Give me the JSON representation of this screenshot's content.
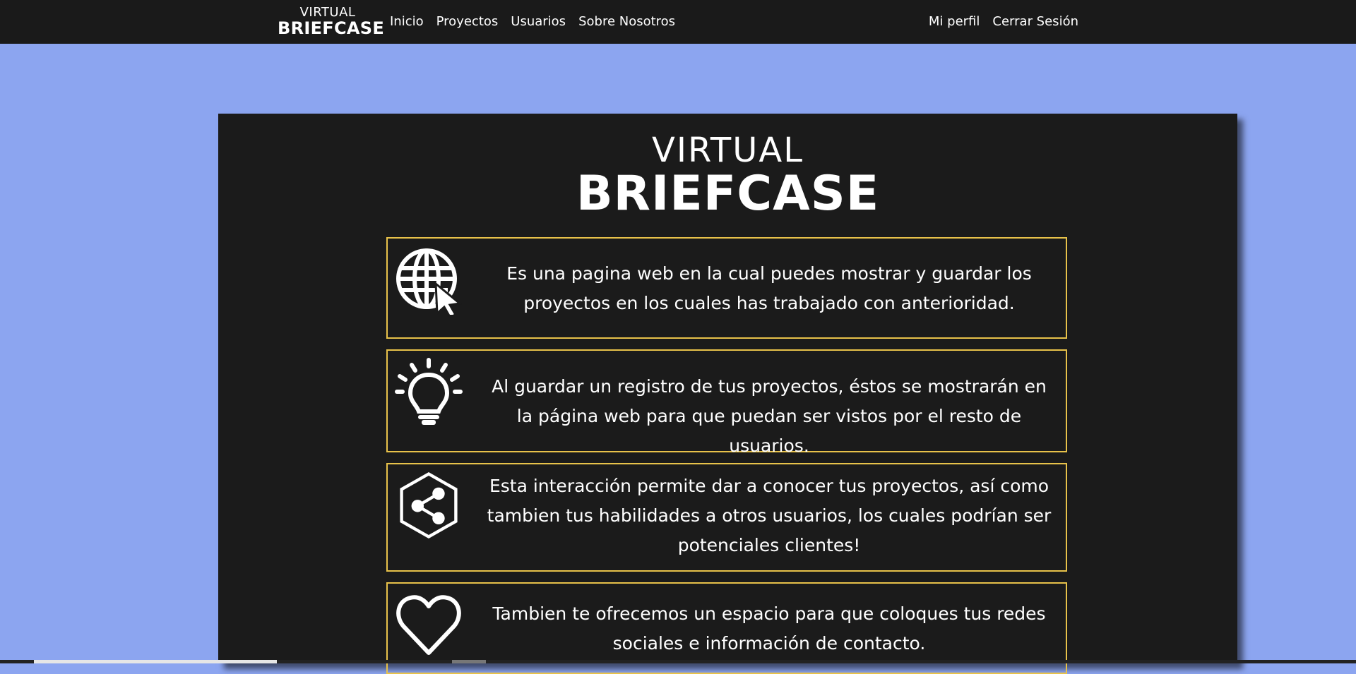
{
  "nav": {
    "logo": {
      "line1": "VIRTUAL",
      "line2": "BRIEFCASE"
    },
    "links": [
      "Inicio",
      "Proyectos",
      "Usuarios",
      "Sobre Nosotros"
    ],
    "right_links": [
      "Mi perfil",
      "Cerrar Sesión"
    ]
  },
  "hero": {
    "line1": "VIRTUAL",
    "line2": "BRIEFCASE"
  },
  "cards": [
    {
      "icon": "globe-cursor-icon",
      "text": "Es una pagina web en la cual puedes mostrar y guardar los proyectos en los cuales has trabajado con anterioridad."
    },
    {
      "icon": "lightbulb-icon",
      "text": "Al guardar un registro de tus proyectos, éstos se mostrarán en la página web para que puedan ser vistos por el resto de usuarios."
    },
    {
      "icon": "share-hexagon-icon",
      "text": "Esta interacción permite dar a conocer tus proyectos, así como tambien tus habilidades a otros usuarios, los cuales podrían ser potenciales clientes!"
    },
    {
      "icon": "heart-icon",
      "text": "Tambien te ofrecemos un espacio para que coloques tus redes sociales e información de contacto."
    }
  ],
  "colors": {
    "background": "#8ca5f0",
    "navbar": "#1a1a1a",
    "panel": "#1b1b1b",
    "card_border": "#e8c24a",
    "text": "#ffffff"
  }
}
